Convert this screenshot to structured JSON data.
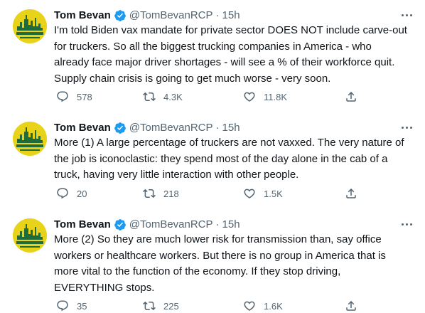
{
  "author": {
    "name": "Tom Bevan",
    "handle": "@TomBevanRCP",
    "separator": "·"
  },
  "tweets": [
    {
      "time": "15h",
      "text": "I'm told Biden vax mandate for private sector DOES NOT include carve-out\nfor truckers.  So all the biggest trucking companies in America - who\nalready face major driver shortages - will see a % of their workforce quit.\nSupply chain crisis is going to get much worse - very soon.",
      "replies": "578",
      "retweets": "4.3K",
      "likes": "11.8K"
    },
    {
      "time": "15h",
      "text": "More (1) A large percentage of truckers are not vaxxed. The very nature of\nthe job is iconoclastic: they spend most of the day alone in the cab of a\ntruck, having very little interaction with other people.",
      "replies": "20",
      "retweets": "218",
      "likes": "1.5K"
    },
    {
      "time": "15h",
      "text": "More (2) So they are much lower risk for transmission than, say office\nworkers or healthcare workers. But there is no group in America that is\nmore vital to the function of the economy. If they stop driving,\nEVERYTHING stops.",
      "replies": "35",
      "retweets": "225",
      "likes": "1.6K"
    }
  ],
  "icons": {
    "reply": "reply-icon",
    "retweet": "retweet-icon",
    "like": "heart-icon",
    "share": "share-icon",
    "more": "more-icon",
    "verified": "verified-badge-icon",
    "avatar": "avatar-logo"
  },
  "colors": {
    "verified": "#1d9bf0",
    "avatar_yellow": "#e8d21a",
    "avatar_green": "#1f6b3a",
    "secondary_text": "#536471",
    "text": "#0f1419"
  }
}
